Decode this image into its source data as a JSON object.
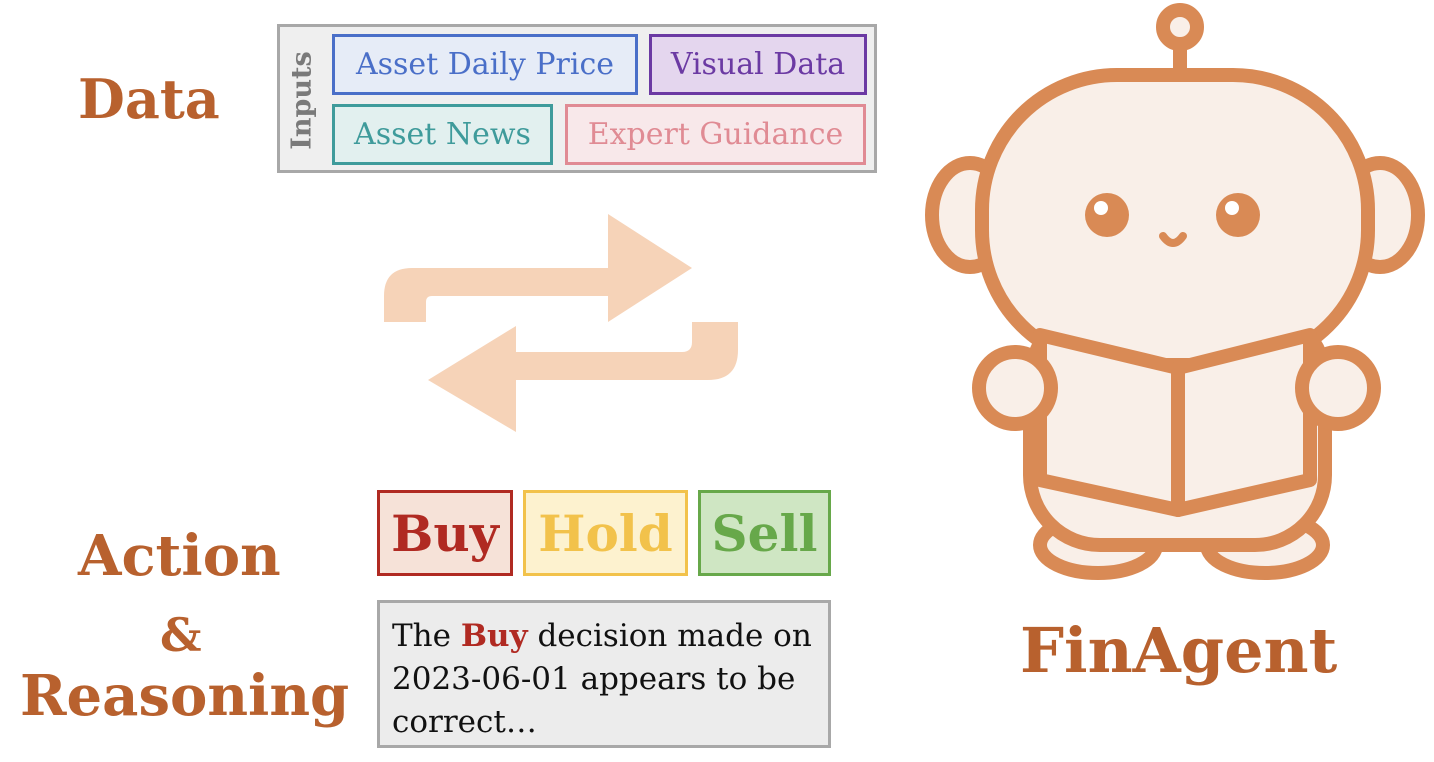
{
  "headings": {
    "data": "Data",
    "action_line1": "Action",
    "action_line2": "&",
    "action_line3": "Reasoning",
    "agent_name": "FinAgent"
  },
  "inputs": {
    "label": "Inputs",
    "chips": [
      {
        "label": "Asset Daily Price",
        "color": "#4a6fc8",
        "bg": "#e6ecf7"
      },
      {
        "label": "Visual Data",
        "color": "#6b3aa3",
        "bg": "#e4d6ee"
      },
      {
        "label": "Asset News",
        "color": "#3f9b9b",
        "bg": "#e2f0ef"
      },
      {
        "label": "Expert Guidance",
        "color": "#e08b94",
        "bg": "#f8e8ea"
      }
    ]
  },
  "actions": [
    {
      "label": "Buy",
      "color": "#b02a22",
      "bg": "#f6e2d8",
      "border": "#b02a22"
    },
    {
      "label": "Hold",
      "color": "#f2c24b",
      "bg": "#fdf2cf",
      "border": "#f2c24b"
    },
    {
      "label": "Sell",
      "color": "#67a84a",
      "bg": "#cfe6c3",
      "border": "#67a84a"
    }
  ],
  "reasoning": {
    "prefix": "The ",
    "highlight": "Buy",
    "suffix": " decision made on 2023-06-01 appears to be correct…"
  },
  "colors": {
    "accent": "#b8612e",
    "arrow": "#f6d3b8",
    "robot_outline": "#d98a55",
    "robot_fill": "#f9efe8"
  },
  "icons": {
    "cycle": "exchange-arrows-icon",
    "agent": "robot-reading-book-icon"
  }
}
